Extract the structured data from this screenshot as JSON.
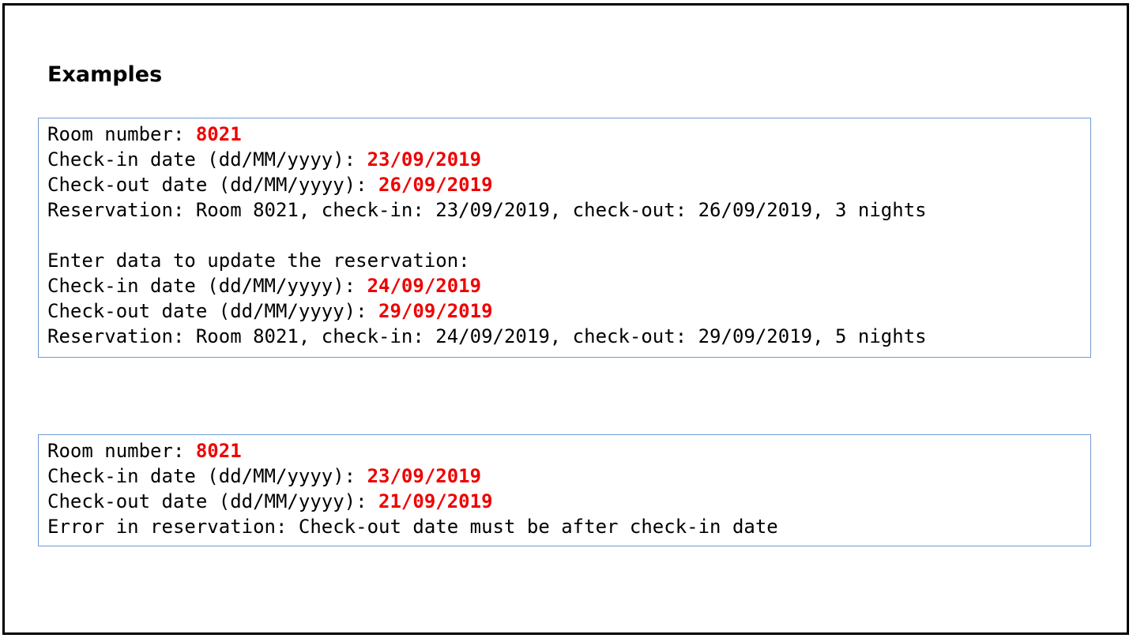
{
  "title": "Examples",
  "colors": {
    "input_value": "#ee0000",
    "box_border": "#6f9ad6",
    "frame_border": "#000000"
  },
  "example1": {
    "room_prompt": "Room number: ",
    "room_value": "8021",
    "checkin_prompt": "Check-in date (dd/MM/yyyy): ",
    "checkin_value": "23/09/2019",
    "checkout_prompt": "Check-out date (dd/MM/yyyy): ",
    "checkout_value": "26/09/2019",
    "reservation_output": "Reservation: Room 8021, check-in: 23/09/2019, check-out: 26/09/2019, 3 nights",
    "update_prompt": "Enter data to update the reservation:",
    "update_checkin_prompt": "Check-in date (dd/MM/yyyy): ",
    "update_checkin_value": "24/09/2019",
    "update_checkout_prompt": "Check-out date (dd/MM/yyyy): ",
    "update_checkout_value": "29/09/2019",
    "updated_reservation_output": "Reservation: Room 8021, check-in: 24/09/2019, check-out: 29/09/2019, 5 nights"
  },
  "example2": {
    "room_prompt": "Room number: ",
    "room_value": "8021",
    "checkin_prompt": "Check-in date (dd/MM/yyyy): ",
    "checkin_value": "23/09/2019",
    "checkout_prompt": "Check-out date (dd/MM/yyyy): ",
    "checkout_value": "21/09/2019",
    "error_output": "Error in reservation: Check-out date must be after check-in date"
  }
}
